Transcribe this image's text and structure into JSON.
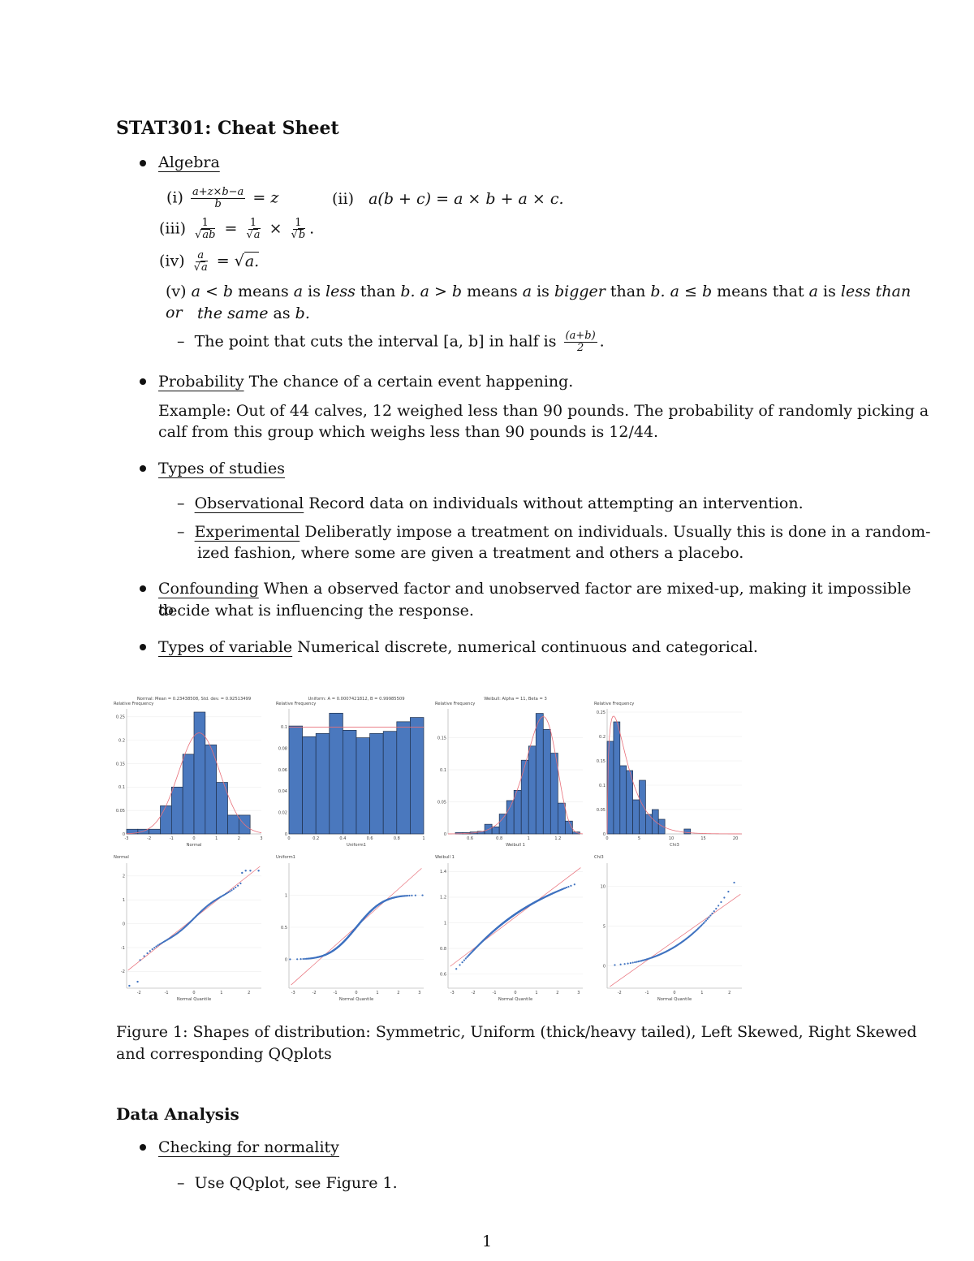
{
  "document": {
    "title": "STAT301: Cheat Sheet",
    "page_number": "1"
  },
  "algebra": {
    "heading": "Algebra",
    "i_label": "(i)",
    "i_num": "a+z×b−a",
    "i_den": "b",
    "i_rhs": "= z",
    "ii_label": "(ii)",
    "ii_expr": "a(b + c) = a × b + a × c.",
    "iii_label": "(iii)",
    "iii_n1": "1",
    "iii_d1": "ab",
    "iii_n2": "1",
    "iii_d2": "a",
    "iii_n3": "1",
    "iii_d3": "b",
    "iv_label": "(iv)",
    "iv_num": "a",
    "iv_den": "a",
    "iv_rhs": "a.",
    "v_label": "(v)",
    "v_line1_parts": [
      "a < b",
      " means ",
      "a",
      " is ",
      "less",
      " than ",
      "b.",
      " a > b",
      " means ",
      "a",
      " is ",
      "bigger",
      " than ",
      "b.",
      " a ≤ b",
      " means that ",
      "a",
      " is ",
      "less than or"
    ],
    "v_line2_a": "the same",
    "v_line2_b": " as ",
    "v_line2_c": "b.",
    "midpoint_text": "The point that cuts the interval [a, b] in half is",
    "midpoint_num": "(a+b)",
    "midpoint_den": "2"
  },
  "probability": {
    "heading": "Probability",
    "definition": "The chance of a certain event happening.",
    "example_line1": "Example: Out of 44 calves, 12 weighed less than 90 pounds. The probability of randomly picking a",
    "example_line2": "calf from this group which weighs less than 90 pounds is 12/44."
  },
  "studies": {
    "heading": "Types of studies",
    "observational_label": "Observational",
    "observational_text": "Record data on individuals without attempting an intervention.",
    "experimental_label": "Experimental",
    "experimental_text1": "Deliberatly impose a treatment on individuals. Usually this is done in a random-",
    "experimental_text2": "ized fashion, where some are given a treatment and others a placebo."
  },
  "confounding": {
    "heading": "Confounding",
    "text1": "When a observed factor and unobserved factor are mixed-up, making it impossible to",
    "text2": "decide what is influencing the response."
  },
  "variables": {
    "heading": "Types of variable",
    "text": "Numerical discrete, numerical continuous and categorical."
  },
  "figure": {
    "caption_line1": "Figure 1: Shapes of distribution: Symmetric, Uniform (thick/heavy tailed), Left Skewed, Right Skewed",
    "caption_line2": "and corresponding QQplots"
  },
  "data_analysis": {
    "heading": "Data Analysis",
    "normality_heading": "Checking for normality",
    "normality_item": "Use QQplot, see Figure 1."
  },
  "colors": {
    "bar_fill": "#4a78be",
    "bar_stroke": "#1f2f4a",
    "curve": "#e8707a",
    "point": "#3f72c0",
    "grid": "#eeeeee",
    "axis_text": "#444444"
  },
  "chart_data": [
    {
      "type": "bar",
      "title": "Normal: Mean = 0.23438508, Std. dev. = 0.92513499",
      "ylabel": "Relative Frequency",
      "xlabel": "Normal",
      "bin_edges": [
        -3,
        -2.5,
        -2,
        -1.5,
        -1,
        -0.5,
        0,
        0.5,
        1,
        1.5,
        2,
        2.5
      ],
      "values": [
        0.01,
        0.01,
        0.01,
        0.06,
        0.1,
        0.17,
        0.26,
        0.19,
        0.11,
        0.04,
        0.04
      ],
      "xlim": [
        -3,
        3
      ],
      "ylim": [
        0,
        0.26
      ],
      "xticks": [
        "-3",
        "-2",
        "-1",
        "0",
        "1",
        "2",
        "3"
      ],
      "xtick_values": [
        -3,
        -2,
        -1,
        0,
        1,
        2,
        3
      ],
      "yticks": [
        "0",
        "0.05",
        "0.1",
        "0.15",
        "0.2",
        "0.25"
      ],
      "ytick_values": [
        0,
        0.05,
        0.1,
        0.15,
        0.2,
        0.25
      ],
      "fit_curve": {
        "dist": "normal",
        "mean": 0.23438508,
        "sd": 0.92513499,
        "scale": 0.5
      }
    },
    {
      "type": "bar",
      "title": "Uniform: A = 0.0007421812, B = 0.99985509",
      "ylabel": "Relative Frequency",
      "xlabel": "Uniform1",
      "bin_edges": [
        0,
        0.1,
        0.2,
        0.3,
        0.4,
        0.5,
        0.6,
        0.7,
        0.8,
        0.9,
        1.0
      ],
      "values": [
        0.101,
        0.091,
        0.094,
        0.113,
        0.097,
        0.09,
        0.094,
        0.096,
        0.105,
        0.109
      ],
      "xlim": [
        0,
        1
      ],
      "ylim": [
        0,
        0.114
      ],
      "xticks": [
        "0",
        "0.2",
        "0.4",
        "0.6",
        "0.8",
        "1"
      ],
      "xtick_values": [
        0,
        0.2,
        0.4,
        0.6,
        0.8,
        1
      ],
      "yticks": [
        "0",
        "0.02",
        "0.04",
        "0.06",
        "0.08",
        "0.1"
      ],
      "ytick_values": [
        0,
        0.02,
        0.04,
        0.06,
        0.08,
        0.1
      ],
      "fit_curve": {
        "dist": "uniform",
        "level": 0.1
      }
    },
    {
      "type": "bar",
      "title": "Weibull: Alpha = 11, Beta = 3",
      "ylabel": "Relative Frequency",
      "xlabel": "Weibull 1",
      "bin_edges": [
        0.5,
        0.55,
        0.6,
        0.65,
        0.7,
        0.75,
        0.8,
        0.85,
        0.9,
        0.95,
        1.0,
        1.05,
        1.1,
        1.15,
        1.2,
        1.25,
        1.3,
        1.35
      ],
      "values": [
        0.002,
        0.002,
        0.003,
        0.004,
        0.015,
        0.011,
        0.031,
        0.052,
        0.068,
        0.115,
        0.137,
        0.188,
        0.163,
        0.126,
        0.048,
        0.02,
        0.003
      ],
      "xlim": [
        0.45,
        1.37
      ],
      "ylim": [
        0,
        0.19
      ],
      "xticks": [
        "0.6",
        "0.8",
        "1",
        "1.2"
      ],
      "xtick_values": [
        0.6,
        0.8,
        1,
        1.2
      ],
      "yticks": [
        "0",
        "0.05",
        "0.1",
        "0.15"
      ],
      "ytick_values": [
        0,
        0.05,
        0.1,
        0.15
      ],
      "fit_curve": {
        "dist": "weibull",
        "k": 11,
        "lambda": 3,
        "peak": 0.183,
        "mode": 1.1
      }
    },
    {
      "type": "bar",
      "title": "",
      "ylabel": "Relative Frequency",
      "xlabel": "Chi3",
      "bin_edges": [
        0,
        1,
        2,
        3,
        4,
        5,
        6,
        7,
        8,
        9,
        10,
        11,
        12,
        13
      ],
      "values": [
        0.19,
        0.23,
        0.14,
        0.13,
        0.07,
        0.11,
        0.04,
        0.05,
        0.03,
        0,
        0,
        0,
        0.01
      ],
      "xlim": [
        0,
        21
      ],
      "ylim": [
        0,
        0.25
      ],
      "xticks": [
        "0",
        "5",
        "10",
        "15",
        "20"
      ],
      "xtick_values": [
        0,
        5,
        10,
        15,
        20
      ],
      "yticks": [
        "0",
        "0.05",
        "0.1",
        "0.15",
        "0.2",
        "0.25"
      ],
      "ytick_values": [
        0,
        0.05,
        0.1,
        0.15,
        0.2,
        0.25
      ],
      "fit_curve": {
        "dist": "chi2",
        "df": 3
      }
    },
    {
      "type": "scatter",
      "title": "",
      "ylabel": "Normal",
      "xlabel": "Normal Quantile",
      "xlim": [
        -2.45,
        2.45
      ],
      "ylim": [
        -2.7,
        2.4
      ],
      "xticks": [
        "-2",
        "-1",
        "0",
        "1",
        "2"
      ],
      "xtick_values": [
        -2,
        -1,
        0,
        1,
        2
      ],
      "yticks": [
        "-2",
        "-1",
        "0",
        "1",
        "2"
      ],
      "ytick_values": [
        -2,
        -1,
        0,
        1,
        2
      ],
      "reference_line": {
        "x": [
          -2.4,
          2.4
        ],
        "y": [
          -1.95,
          2.4
        ]
      },
      "shape": "normal",
      "outliers": [
        [
          -2.35,
          -2.6
        ],
        [
          -2.05,
          -2.43
        ],
        [
          1.75,
          2.13
        ],
        [
          1.88,
          2.22
        ],
        [
          2.05,
          2.22
        ],
        [
          2.35,
          2.22
        ]
      ]
    },
    {
      "type": "scatter",
      "title": "",
      "ylabel": "Uniform1",
      "xlabel": "Normal Quantile",
      "xlim": [
        -3.2,
        3.2
      ],
      "ylim": [
        -0.45,
        1.45
      ],
      "xticks": [
        "-3",
        "-2",
        "-1",
        "0",
        "1",
        "2",
        "3"
      ],
      "xtick_values": [
        -3,
        -2,
        -1,
        0,
        1,
        2,
        3
      ],
      "yticks": [
        "0",
        "0.5",
        "1"
      ],
      "ytick_values": [
        0,
        0.5,
        1
      ],
      "reference_line": {
        "x": [
          -3.1,
          3.1
        ],
        "y": [
          -0.4,
          1.42
        ]
      },
      "shape": "uniform"
    },
    {
      "type": "scatter",
      "title": "",
      "ylabel": "Weibull 1",
      "xlabel": "Normal Quantile",
      "xlim": [
        -3.2,
        3.2
      ],
      "ylim": [
        0.49,
        1.44
      ],
      "xticks": [
        "-3",
        "-2",
        "-1",
        "0",
        "1",
        "2",
        "3"
      ],
      "xtick_values": [
        -3,
        -2,
        -1,
        0,
        1,
        2,
        3
      ],
      "yticks": [
        "0.6",
        "0.8",
        "1",
        "1.2",
        "1.4"
      ],
      "ytick_values": [
        0.6,
        0.8,
        1,
        1.2,
        1.4
      ],
      "reference_line": {
        "x": [
          -3.1,
          3.1
        ],
        "y": [
          0.66,
          1.43
        ]
      },
      "shape": "weibull"
    },
    {
      "type": "scatter",
      "title": "",
      "ylabel": "Chi3",
      "xlabel": "Normal Quantile",
      "xlim": [
        -2.45,
        2.45
      ],
      "ylim": [
        -2.8,
        12.5
      ],
      "xticks": [
        "-2",
        "-1",
        "0",
        "1",
        "2"
      ],
      "xtick_values": [
        -2,
        -1,
        0,
        1,
        2
      ],
      "yticks": [
        "0",
        "5",
        "10"
      ],
      "ytick_values": [
        0,
        5,
        10
      ],
      "reference_line": {
        "x": [
          -2.35,
          2.4
        ],
        "y": [
          -2.6,
          9.0
        ]
      },
      "shape": "chi2"
    }
  ]
}
